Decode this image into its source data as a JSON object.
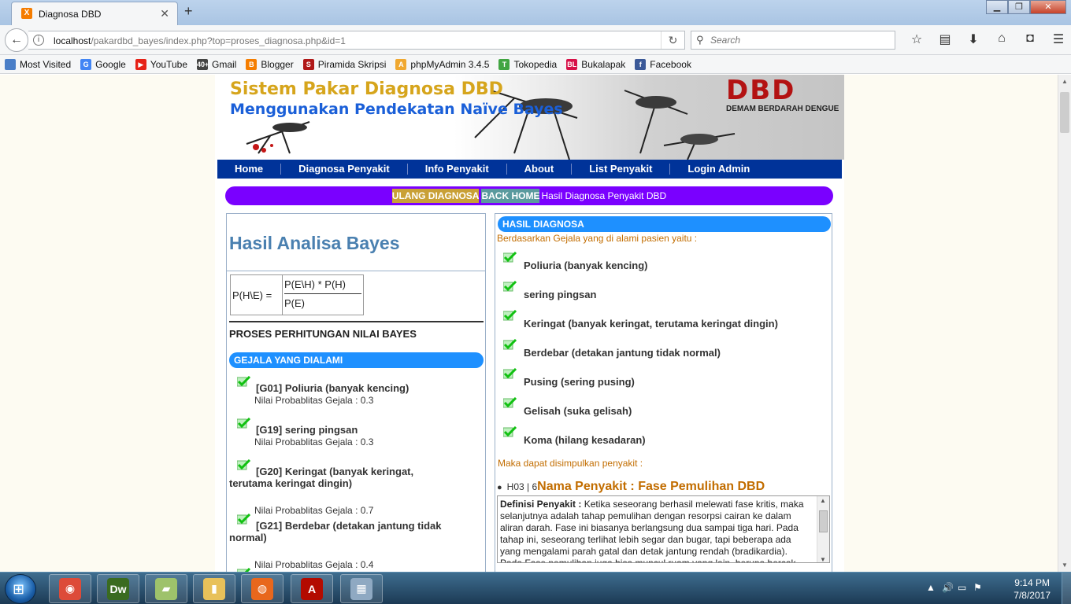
{
  "browser": {
    "tab_title": "Diagnosa DBD",
    "tab_icon_letter": "X",
    "url_host": "localhost",
    "url_path": "/pakardbd_bayes/index.php?top=proses_diagnosa.php&id=1",
    "search_placeholder": "Search",
    "bookmarks": [
      {
        "label": "Most Visited",
        "icon": "firefox-icon",
        "color": "#4a7ec7",
        "glyph": ""
      },
      {
        "label": "Google",
        "icon": "google-icon",
        "color": "#4285f4",
        "glyph": "G"
      },
      {
        "label": "YouTube",
        "icon": "youtube-icon",
        "color": "#e62117",
        "glyph": "▶"
      },
      {
        "label": "Gmail",
        "icon": "gmail-icon",
        "color": "#444444",
        "glyph": "40+"
      },
      {
        "label": "Blogger",
        "icon": "blogger-icon",
        "color": "#f57d00",
        "glyph": "B"
      },
      {
        "label": "Piramida Skripsi",
        "icon": "piramida-icon",
        "color": "#b01818",
        "glyph": "S"
      },
      {
        "label": "phpMyAdmin 3.4.5",
        "icon": "phpmyadmin-icon",
        "color": "#f0a830",
        "glyph": "A"
      },
      {
        "label": "Tokopedia",
        "icon": "tokopedia-icon",
        "color": "#42a542",
        "glyph": "T"
      },
      {
        "label": "Bukalapak",
        "icon": "bukalapak-icon",
        "color": "#d71149",
        "glyph": "BL"
      },
      {
        "label": "Facebook",
        "icon": "facebook-icon",
        "color": "#3b5998",
        "glyph": "f"
      }
    ]
  },
  "banner": {
    "title_line1": "Sistem Pakar Diagnosa DBD",
    "title_line2": "Menggunakan Pendekatan Naïve Bayes",
    "dbd_text": "DBD",
    "dbd_sub": "DEMAM BERDARAH DENGUE"
  },
  "menu": [
    "Home",
    "Diagnosa Penyakit",
    "Info Penyakit",
    "About",
    "List Penyakit",
    "Login Admin"
  ],
  "pill": {
    "ulang": "ULANG DIAGNOSA",
    "back": "BACK HOME",
    "text": "Hasil Diagnosa Penyakit DBD"
  },
  "left": {
    "heading": "Hasil Analisa Bayes",
    "formula_lhs": "P(H\\E) =",
    "formula_num": "P(E\\H) * P(H)",
    "formula_den": "P(E)",
    "proses_title": "PROSES PERHITUNGAN NILAI BAYES",
    "gejala_title": "GEJALA YANG DIALAMI",
    "gejala": [
      {
        "label": "[G01] Poliuria (banyak kencing)",
        "prob": "Nilai Probablitas Gejala : 0.3"
      },
      {
        "label": "[G19] sering pingsan",
        "prob": "Nilai Probablitas Gejala : 0.3"
      },
      {
        "label": "[G20] Keringat (banyak keringat, terutama keringat dingin)",
        "prob": "Nilai Probablitas Gejala : 0.7"
      },
      {
        "label": "[G21] Berdebar (detakan jantung tidak normal)",
        "prob": "Nilai Probablitas Gejala : 0.4"
      }
    ]
  },
  "right": {
    "title": "HASIL DIAGNOSA",
    "intro": "Berdasarkan Gejala yang di alami pasien yaitu :",
    "gejala": [
      "Poliuria (banyak kencing)",
      "sering pingsan",
      "Keringat (banyak keringat, terutama keringat dingin)",
      "Berdebar (detakan jantung tidak normal)",
      "Pusing (sering pusing)",
      "Gelisah (suka gelisah)",
      "Koma (hilang kesadaran)"
    ],
    "conclusion": "Maka dapat disimpulkan penyakit :",
    "result_code": "H03 | 6",
    "result_name": "Nama Penyakit : Fase Pemulihan DBD",
    "def_label": "Definisi Penyakit :",
    "def_text": " Ketika seseorang berhasil melewati fase kritis, maka selanjutnya adalah tahap pemulihan dengan resorpsi cairan ke dalam aliran darah. Fase ini biasanya berlangsung dua sampai tiga hari. Pada tahap ini, seseorang terlihat lebih segar dan bugar, tapi beberapa ada yang mengalami parah gatal dan detak jantung rendah (bradikardia). Pada Fase pemulihan juga bisa muncul ruam yang lain, berupa bercak"
  },
  "taskbar": {
    "apps": [
      {
        "name": "chrome",
        "glyph": "◉",
        "color": "#dd4b39"
      },
      {
        "name": "dreamweaver",
        "glyph": "Dw",
        "color": "#3a6b20"
      },
      {
        "name": "windows-explorer-files",
        "glyph": "▰",
        "color": "#9ec26b"
      },
      {
        "name": "folder",
        "glyph": "▮",
        "color": "#e8c15a"
      },
      {
        "name": "firefox",
        "glyph": "◍",
        "color": "#e8671d"
      },
      {
        "name": "acrobat",
        "glyph": "A",
        "color": "#b30b00"
      },
      {
        "name": "calculator",
        "glyph": "▦",
        "color": "#8fa9c2"
      }
    ],
    "time": "9:14 PM",
    "date": "7/8/2017"
  }
}
